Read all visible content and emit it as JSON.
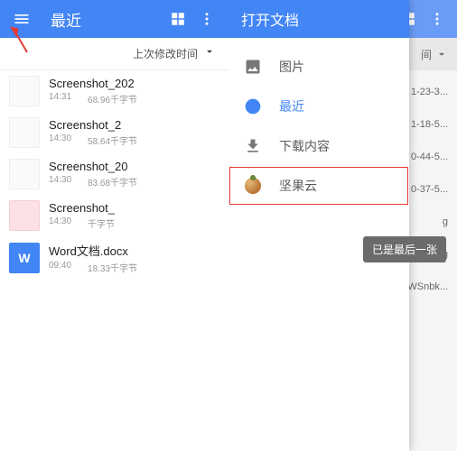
{
  "left": {
    "title": "最近",
    "sort_label": "上次修改时间",
    "files": [
      {
        "name": "Screenshot_202",
        "time": "14:31",
        "size": "68.96千字节",
        "thumb": "plain"
      },
      {
        "name": "Screenshot_2",
        "time": "14:30",
        "size": "58.64千字节",
        "thumb": "plain"
      },
      {
        "name": "Screenshot_20",
        "time": "14:30",
        "size": "83.68千字节",
        "thumb": "plain"
      },
      {
        "name": "Screenshot_",
        "time": "14:30",
        "size": "千字节",
        "thumb": "pink"
      },
      {
        "name": "Word文档.docx",
        "time": "09:40",
        "size": "18.33千字节",
        "thumb": "word",
        "glyph": "W"
      }
    ]
  },
  "right": {
    "drawer_title": "打开文档",
    "items": [
      {
        "label": "图片",
        "icon": "image",
        "active": false,
        "highlight": false
      },
      {
        "label": "最近",
        "icon": "recent",
        "active": true,
        "highlight": false
      },
      {
        "label": "下载内容",
        "icon": "download",
        "active": false,
        "highlight": false
      },
      {
        "label": "坚果云",
        "icon": "nut",
        "active": false,
        "highlight": true
      }
    ],
    "toast": "已是最后一张",
    "bg_sort": "间",
    "bg_files": [
      "1-23-3...",
      "1-18-5...",
      "0-44-5...",
      "0-37-5...",
      "g",
      "g",
      "WSnbk..."
    ]
  }
}
